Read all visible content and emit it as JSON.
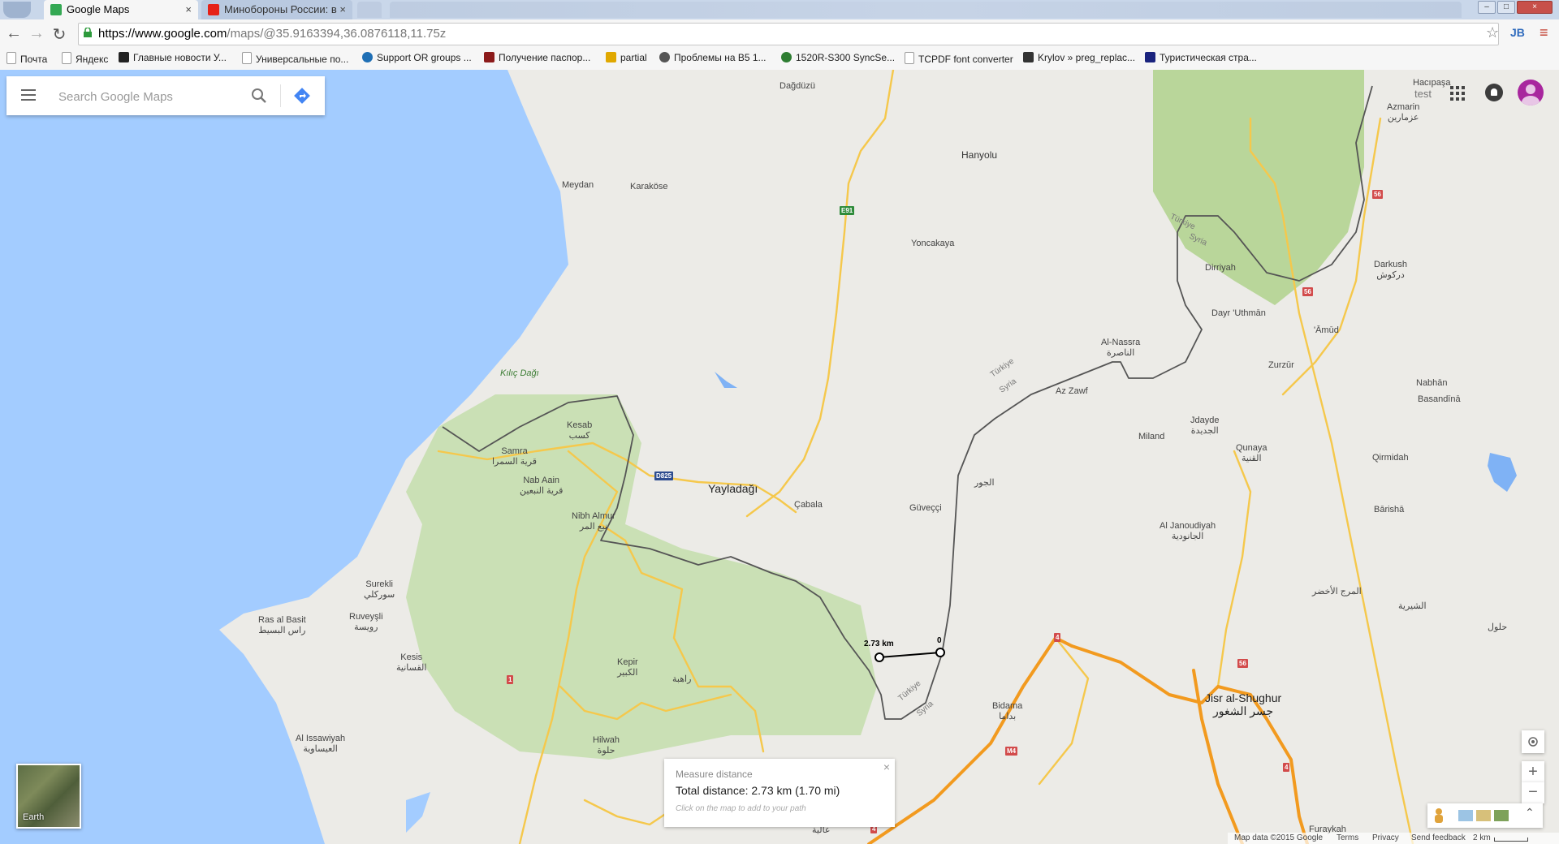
{
  "tabs": [
    {
      "title": "Google Maps",
      "active": true,
      "favicon_color": "#34a853"
    },
    {
      "title": "Минобороны России: в ",
      "active": false,
      "favicon_color": "#e62117"
    }
  ],
  "address": {
    "host": "https://www.google.com",
    "path": "/maps/@35.9163394,36.0876118,11.75z"
  },
  "bookmarks": [
    {
      "label": "Почта",
      "icon": "page-icon"
    },
    {
      "label": "Яндекс",
      "icon": "page-icon"
    },
    {
      "label": "Главные новости У...",
      "icon": "news-icon"
    },
    {
      "label": "Универсальные по...",
      "icon": "page-icon"
    },
    {
      "label": "Support OR groups ...",
      "icon": "globe-icon"
    },
    {
      "label": "Получение паспор...",
      "icon": "red-icon"
    },
    {
      "label": "partial",
      "icon": "shield-icon"
    },
    {
      "label": "Проблемы на B5 1...",
      "icon": "circle-icon"
    },
    {
      "label": "1520R-S300 SyncSe...",
      "icon": "sync-icon"
    },
    {
      "label": "TCPDF font converter",
      "icon": "page-icon"
    },
    {
      "label": "Krylov » preg_replac...",
      "icon": "k-icon"
    },
    {
      "label": "Туристическая стра...",
      "icon": "site-icon"
    }
  ],
  "search": {
    "placeholder": "Search Google Maps"
  },
  "account": {
    "label": "test"
  },
  "places": [
    {
      "name": "Dağdüzü",
      "cls": "pl"
    },
    {
      "name": "Hanyolu",
      "cls": "pl"
    },
    {
      "name": "Meydan",
      "cls": "pl"
    },
    {
      "name": "Karaköse",
      "cls": "pl"
    },
    {
      "name": "Yoncakaya",
      "cls": "pl"
    },
    {
      "name": "Dirriyah",
      "cls": "pl"
    },
    {
      "name": "Dayr 'Uthmān",
      "cls": "pl"
    },
    {
      "name": "Darkush\nدركوش",
      "cls": "pl"
    },
    {
      "name": "'Āmūd",
      "cls": "pl"
    },
    {
      "name": "Hacıpaşa",
      "cls": "pl"
    },
    {
      "name": "Azmarin\nعزمارين",
      "cls": "pl"
    },
    {
      "name": "Al-Nassra\nالناصرة",
      "cls": "pl"
    },
    {
      "name": "Az Zawf",
      "cls": "pl"
    },
    {
      "name": "Zurzūr",
      "cls": "pl"
    },
    {
      "name": "Nabhān",
      "cls": "pl"
    },
    {
      "name": "Basandīnā",
      "cls": "pl"
    },
    {
      "name": "Kılıç Dağı",
      "cls": "pl park"
    },
    {
      "name": "Kesab\nكسب",
      "cls": "pl"
    },
    {
      "name": "Samra\nقرية السمرا",
      "cls": "pl"
    },
    {
      "name": "Nab Aain\nقرية النبعين",
      "cls": "pl"
    },
    {
      "name": "Nibh Almur\nنبع المر",
      "cls": "pl"
    },
    {
      "name": "Yayladağı",
      "cls": "pl big"
    },
    {
      "name": "Çabala",
      "cls": "pl"
    },
    {
      "name": "Güveççi",
      "cls": "pl"
    },
    {
      "name": "الجور",
      "cls": "pl"
    },
    {
      "name": "Miland",
      "cls": "pl"
    },
    {
      "name": "Jdayde\nالجديدة",
      "cls": "pl"
    },
    {
      "name": "Qunaya\nالقنية",
      "cls": "pl"
    },
    {
      "name": "Qirmidah",
      "cls": "pl"
    },
    {
      "name": "Bārishā",
      "cls": "pl"
    },
    {
      "name": "Al Janoudiyah\nالجانودية",
      "cls": "pl"
    },
    {
      "name": "المرج الأخضر",
      "cls": "pl"
    },
    {
      "name": "الشيرية",
      "cls": "pl"
    },
    {
      "name": "حلول",
      "cls": "pl"
    },
    {
      "name": "Surekli\nسوركلي",
      "cls": "pl"
    },
    {
      "name": "Ras al Basit\nراس البسيط",
      "cls": "pl"
    },
    {
      "name": "Ruveyşli\nرويسة",
      "cls": "pl"
    },
    {
      "name": "Kesis\nالقسانية",
      "cls": "pl"
    },
    {
      "name": "Kepir\nالكبير",
      "cls": "pl"
    },
    {
      "name": "راهبة",
      "cls": "pl"
    },
    {
      "name": "Bidama\nبداما",
      "cls": "pl"
    },
    {
      "name": "Jisr al-Shughur\nجسر الشغور",
      "cls": "pl big"
    },
    {
      "name": "Al Issawiyah\nالعيساوية",
      "cls": "pl"
    },
    {
      "name": "Hilwah\nحلوة",
      "cls": "pl"
    },
    {
      "name": "Furaykah",
      "cls": "pl"
    },
    {
      "name": "عالية",
      "cls": "pl"
    }
  ],
  "road_badges": [
    "E91",
    "D825",
    "56",
    "56",
    "56",
    "4",
    "4",
    "M4",
    "1",
    "4"
  ],
  "border_labels": [
    "Türkiye",
    "Syria",
    "Türkiye",
    "Syria",
    "Türkiye",
    "Syria"
  ],
  "measure": {
    "point_a_label": "2.73 km",
    "point_b_label": "0",
    "title": "Measure distance",
    "total": "Total distance: 2.73 km (1.70 mi)",
    "hint": "Click on the map to add to your path",
    "close": "×"
  },
  "earth": {
    "label": "Earth"
  },
  "zoom": {
    "in": "+",
    "out": "−"
  },
  "footer": {
    "data": "Map data ©2015 Google",
    "terms": "Terms",
    "privacy": "Privacy",
    "feedback": "Send feedback",
    "scale": "2 km"
  },
  "colors": {
    "water": "#a3ccff",
    "land": "#ecebe7",
    "park": "#c8dfb2",
    "road": "#f5c84c",
    "highway": "#f29a1f",
    "border": "#555555"
  }
}
